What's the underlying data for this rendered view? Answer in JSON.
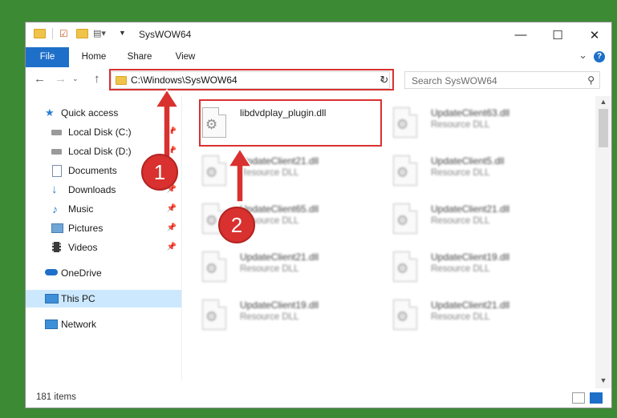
{
  "window": {
    "title": "SysWOW64",
    "minimize_label": "—",
    "maximize_label": "☐",
    "close_label": "✕"
  },
  "ribbon": {
    "tabs": [
      "File",
      "Home",
      "Share",
      "View"
    ],
    "help_label": "?"
  },
  "address_bar": {
    "path": "C:\\Windows\\SysWOW64",
    "search_placeholder": "Search SysWOW64"
  },
  "sidebar": {
    "items": [
      {
        "label": "Quick access",
        "icon": "star-icon",
        "pinned": false
      },
      {
        "label": "Local Disk (C:)",
        "icon": "drive-icon",
        "pinned": true
      },
      {
        "label": "Local Disk (D:)",
        "icon": "drive-icon",
        "pinned": true
      },
      {
        "label": "Documents",
        "icon": "documents-icon",
        "pinned": true
      },
      {
        "label": "Downloads",
        "icon": "download-arrow-icon",
        "pinned": true
      },
      {
        "label": "Music",
        "icon": "music-note-icon",
        "pinned": true
      },
      {
        "label": "Pictures",
        "icon": "pictures-icon",
        "pinned": true
      },
      {
        "label": "Videos",
        "icon": "video-film-icon",
        "pinned": true
      },
      {
        "label": "OneDrive",
        "icon": "cloud-icon",
        "pinned": false
      },
      {
        "label": "This PC",
        "icon": "computer-icon",
        "pinned": false,
        "selected": true
      },
      {
        "label": "Network",
        "icon": "network-icon",
        "pinned": false
      }
    ]
  },
  "files": [
    {
      "name": "libdvdplay_plugin.dll",
      "type": ""
    },
    {
      "name": "UpdateClient63.dll",
      "type": "Resource DLL"
    },
    {
      "name": "UpdateClient21.dll",
      "type": "Resource DLL"
    },
    {
      "name": "UpdateClient5.dll",
      "type": "Resource DLL"
    },
    {
      "name": "UpdateClient65.dll",
      "type": "Resource DLL"
    },
    {
      "name": "UpdateClient21.dll",
      "type": "Resource DLL"
    },
    {
      "name": "UpdateClient21.dll",
      "type": "Resource DLL"
    },
    {
      "name": "UpdateClient19.dll",
      "type": "Resource DLL"
    },
    {
      "name": "UpdateClient19.dll",
      "type": "Resource DLL"
    },
    {
      "name": "UpdateClient21.dll",
      "type": "Resource DLL"
    }
  ],
  "status": {
    "item_count": "181 items"
  },
  "annotations": {
    "step1": "1",
    "step2": "2",
    "color": "#d9312f"
  }
}
